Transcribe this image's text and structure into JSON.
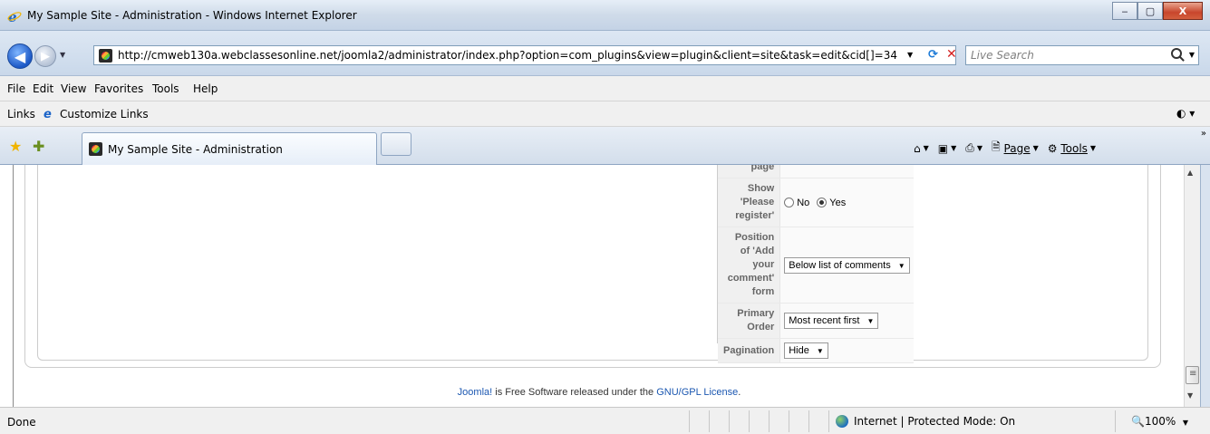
{
  "window": {
    "title": "My Sample Site - Administration - Windows Internet Explorer",
    "minimize_label": "‒",
    "maximize_label": "▢",
    "close_label": "X"
  },
  "address": {
    "url": "http://cmweb130a.webclassesonline.net/joomla2/administrator/index.php?option=com_plugins&view=plugin&client=site&task=edit&cid[]=34",
    "search_placeholder": "Live Search"
  },
  "menu": {
    "items": [
      "File",
      "Edit",
      "View",
      "Favorites",
      "Tools",
      "Help"
    ]
  },
  "links_bar": {
    "label": "Links",
    "customize": "Customize Links"
  },
  "tabs": {
    "active_title": "My Sample Site - Administration"
  },
  "command_bar": {
    "page_label": "Page",
    "tools_label": "Tools"
  },
  "params": {
    "rows": [
      {
        "label": "page",
        "type": "none"
      },
      {
        "label": "Show 'Please register'",
        "type": "radio",
        "options": [
          "No",
          "Yes"
        ],
        "selected": "Yes"
      },
      {
        "label": "Position of 'Add your comment' form",
        "type": "select",
        "value": "Below list of comments"
      },
      {
        "label": "Primary Order",
        "type": "select",
        "value": "Most recent first"
      },
      {
        "label": "Pagination",
        "type": "select",
        "value": "Hide"
      }
    ]
  },
  "footer": {
    "joomla_link": "Joomla!",
    "middle_text": " is Free Software released under the ",
    "license_link": "GNU/GPL License",
    "end_text": "."
  },
  "status": {
    "text": "Done",
    "zone": "Internet | Protected Mode: On",
    "zoom": "100%"
  }
}
